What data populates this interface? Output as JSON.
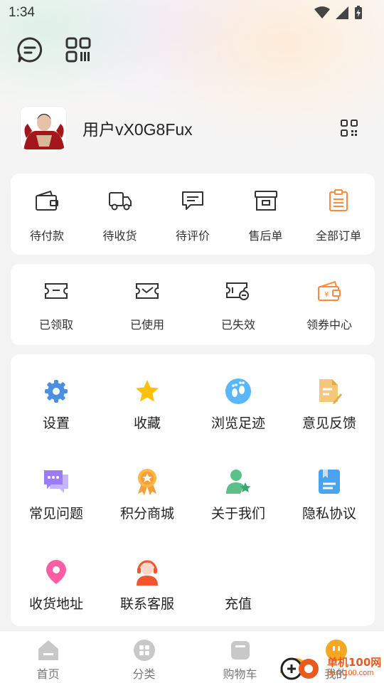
{
  "status": {
    "time": "1:34"
  },
  "profile": {
    "username": "用户vX0G8Fux"
  },
  "orders": [
    {
      "label": "待付款",
      "icon": "wallet-icon"
    },
    {
      "label": "待收货",
      "icon": "truck-icon"
    },
    {
      "label": "待评价",
      "icon": "comment-icon"
    },
    {
      "label": "售后单",
      "icon": "archive-box-icon"
    },
    {
      "label": "全部订单",
      "icon": "clipboard-icon"
    }
  ],
  "coupons": [
    {
      "label": "已领取",
      "icon": "ticket-icon"
    },
    {
      "label": "已使用",
      "icon": "ticket-check-icon"
    },
    {
      "label": "已失效",
      "icon": "ticket-expired-icon"
    },
    {
      "label": "领券中心",
      "icon": "coupon-wallet-icon"
    }
  ],
  "services": [
    {
      "label": "设置",
      "icon": "gear-icon"
    },
    {
      "label": "收藏",
      "icon": "star-icon"
    },
    {
      "label": "浏览足迹",
      "icon": "footprint-icon"
    },
    {
      "label": "意见反馈",
      "icon": "feedback-doc-icon"
    },
    {
      "label": "常见问题",
      "icon": "chat-bubbles-icon"
    },
    {
      "label": "积分商城",
      "icon": "medal-icon"
    },
    {
      "label": "关于我们",
      "icon": "user-star-icon"
    },
    {
      "label": "隐私协议",
      "icon": "document-icon"
    },
    {
      "label": "收货地址",
      "icon": "location-pin-icon"
    },
    {
      "label": "联系客服",
      "icon": "headset-agent-icon"
    },
    {
      "label": "充值",
      "icon": ""
    }
  ],
  "tabs": [
    {
      "label": "首页",
      "icon": "home-icon"
    },
    {
      "label": "分类",
      "icon": "category-grid-icon"
    },
    {
      "label": "购物车",
      "icon": "shopping-cart-icon"
    },
    {
      "label": "我的",
      "icon": "profile-face-icon"
    }
  ],
  "watermark": {
    "line1": "单机100网",
    "line2": "danji100.com"
  },
  "colors": {
    "accent": "#ff8a3d",
    "icon_gray": "#333333",
    "card_bg": "#ffffff",
    "page_bg": "#f3f3f3",
    "tab_icon": "#c8c8c8"
  }
}
